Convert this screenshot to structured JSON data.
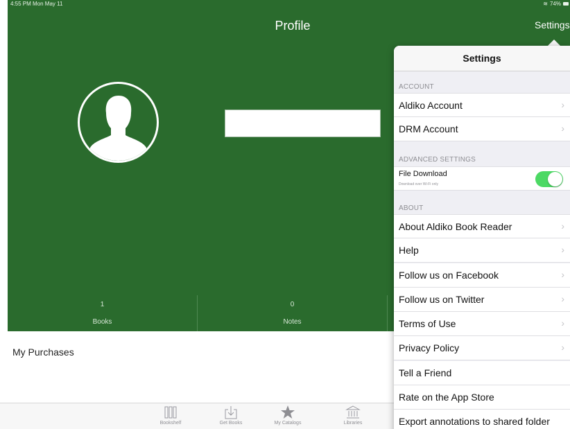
{
  "status_bar": {
    "time": "4:55 PM  Mon May 11",
    "battery": "74%"
  },
  "header": {
    "title": "Profile",
    "settings_label": "Settings"
  },
  "stats": [
    {
      "value": "1",
      "label": "Books"
    },
    {
      "value": "0",
      "label": "Notes"
    }
  ],
  "purchases_label": "My Purchases",
  "tabbar": [
    {
      "label": "Bookshelf",
      "icon": "bookshelf-icon"
    },
    {
      "label": "Get Books",
      "icon": "download-icon"
    },
    {
      "label": "My Catalogs",
      "icon": "star-icon"
    },
    {
      "label": "Libraries",
      "icon": "library-icon"
    }
  ],
  "settings_popover": {
    "title": "Settings",
    "sections": {
      "account": "ACCOUNT",
      "advanced": "ADVANCED SETTINGS",
      "about": "ABOUT"
    },
    "account_rows": [
      "Aldiko Account",
      "DRM Account"
    ],
    "file_download": {
      "label": "File Download",
      "sublabel": "Download over Wi-Fi only",
      "enabled": true
    },
    "about_rows": [
      "About Aldiko Book Reader",
      "Help",
      "Follow us on Facebook",
      "Follow us on Twitter",
      "Terms of Use",
      "Privacy Policy",
      "Tell a Friend",
      "Rate on the App Store",
      "Export annotations to shared folder"
    ]
  },
  "colors": {
    "header_green": "#2a6b2d",
    "toggle_on": "#4cd964"
  }
}
